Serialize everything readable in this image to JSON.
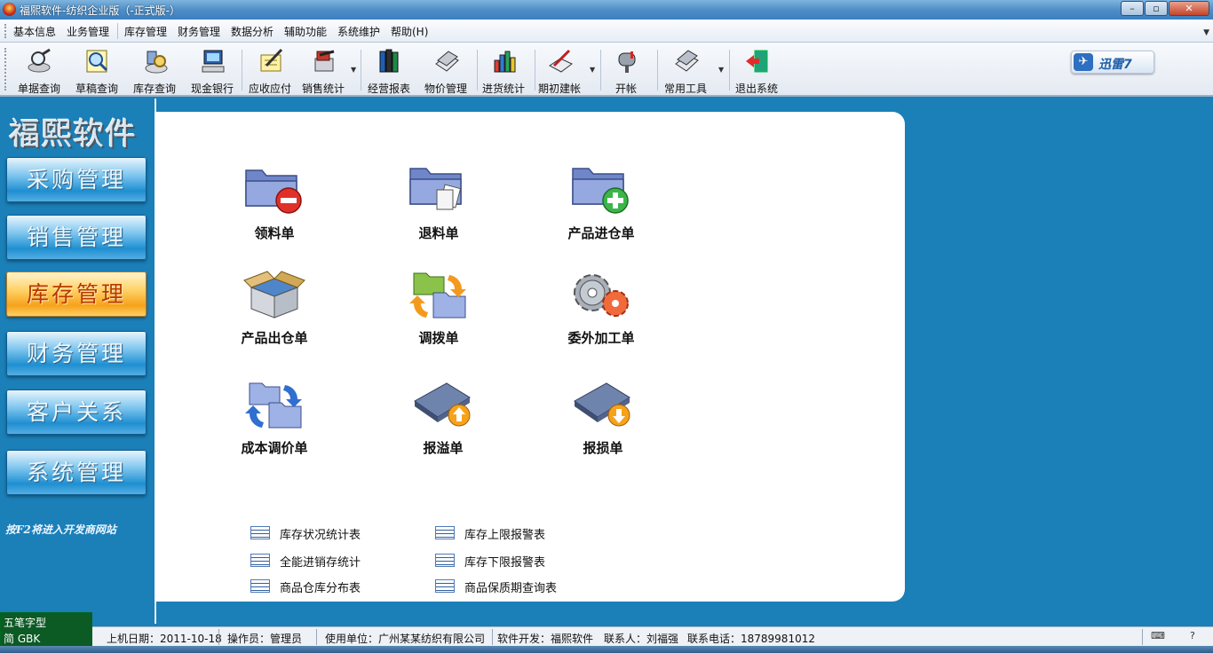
{
  "window": {
    "title": "福熙软件-纺织企业版（-正式版-）",
    "controls": {
      "minimize": "–",
      "maximize": "▫",
      "close": "✕"
    }
  },
  "menu": [
    "基本信息",
    "业务管理",
    "库存管理",
    "财务管理",
    "数据分析",
    "辅助功能",
    "系统维护",
    "帮助(H)"
  ],
  "toolbar": [
    {
      "label": "单据查询",
      "icon": "magnifier-disc-icon"
    },
    {
      "label": "草稿查询",
      "icon": "magnifier-note-icon"
    },
    {
      "label": "库存查询",
      "icon": "stock-query-icon"
    },
    {
      "label": "现金银行",
      "icon": "computer-icon"
    },
    {
      "label": "应收应付",
      "icon": "pen-document-icon"
    },
    {
      "label": "销售统计",
      "icon": "sales-stat-icon"
    },
    {
      "label": "经营报表",
      "icon": "books-icon"
    },
    {
      "label": "物价管理",
      "icon": "price-docs-icon"
    },
    {
      "label": "进货统计",
      "icon": "bar-chart-icon"
    },
    {
      "label": "期初建帐",
      "icon": "pen-book-icon"
    },
    {
      "label": "开帐",
      "icon": "mailbox-icon"
    },
    {
      "label": "常用工具",
      "icon": "tools-icon"
    },
    {
      "label": "退出系统",
      "icon": "exit-door-icon"
    }
  ],
  "xunlei": {
    "label": "迅雷7"
  },
  "sidebar": {
    "brand": "福熙软件",
    "items": [
      "采购管理",
      "销售管理",
      "库存管理",
      "财务管理",
      "客户关系",
      "系统管理"
    ],
    "active": "库存管理",
    "hint": "按F2将进入开发商网站"
  },
  "functions": [
    {
      "label": "领料单",
      "icon": "folder-minus-icon"
    },
    {
      "label": "退料单",
      "icon": "folder-docs-icon"
    },
    {
      "label": "产品进仓单",
      "icon": "folder-plus-icon"
    },
    {
      "label": "产品出仓单",
      "icon": "open-box-icon"
    },
    {
      "label": "调拨单",
      "icon": "folder-transfer-icon"
    },
    {
      "label": "委外加工单",
      "icon": "gears-icon"
    },
    {
      "label": "成本调价单",
      "icon": "folder-cycle-icon"
    },
    {
      "label": "报溢单",
      "icon": "board-up-icon"
    },
    {
      "label": "报损单",
      "icon": "board-down-icon"
    }
  ],
  "reports": [
    "库存状况统计表",
    "库存上限报警表",
    "全能进销存统计",
    "库存下限报警表",
    "商品仓库分布表",
    "商品保质期查询表"
  ],
  "ime": {
    "line1": "五笔字型",
    "line2": "简 GBK"
  },
  "status": {
    "login_date": "上机日期：2011-10-18",
    "operator": "操作员：管理员",
    "company": "使用单位：广州某某纺织有限公司",
    "developer": "软件开发：福熙软件",
    "contact": "联系人：刘福强",
    "phone": "联系电话：18789981012"
  },
  "colors": {
    "background": "#1b7fb8",
    "active_nav": "#f6a21a",
    "panel": "#ffffff"
  }
}
